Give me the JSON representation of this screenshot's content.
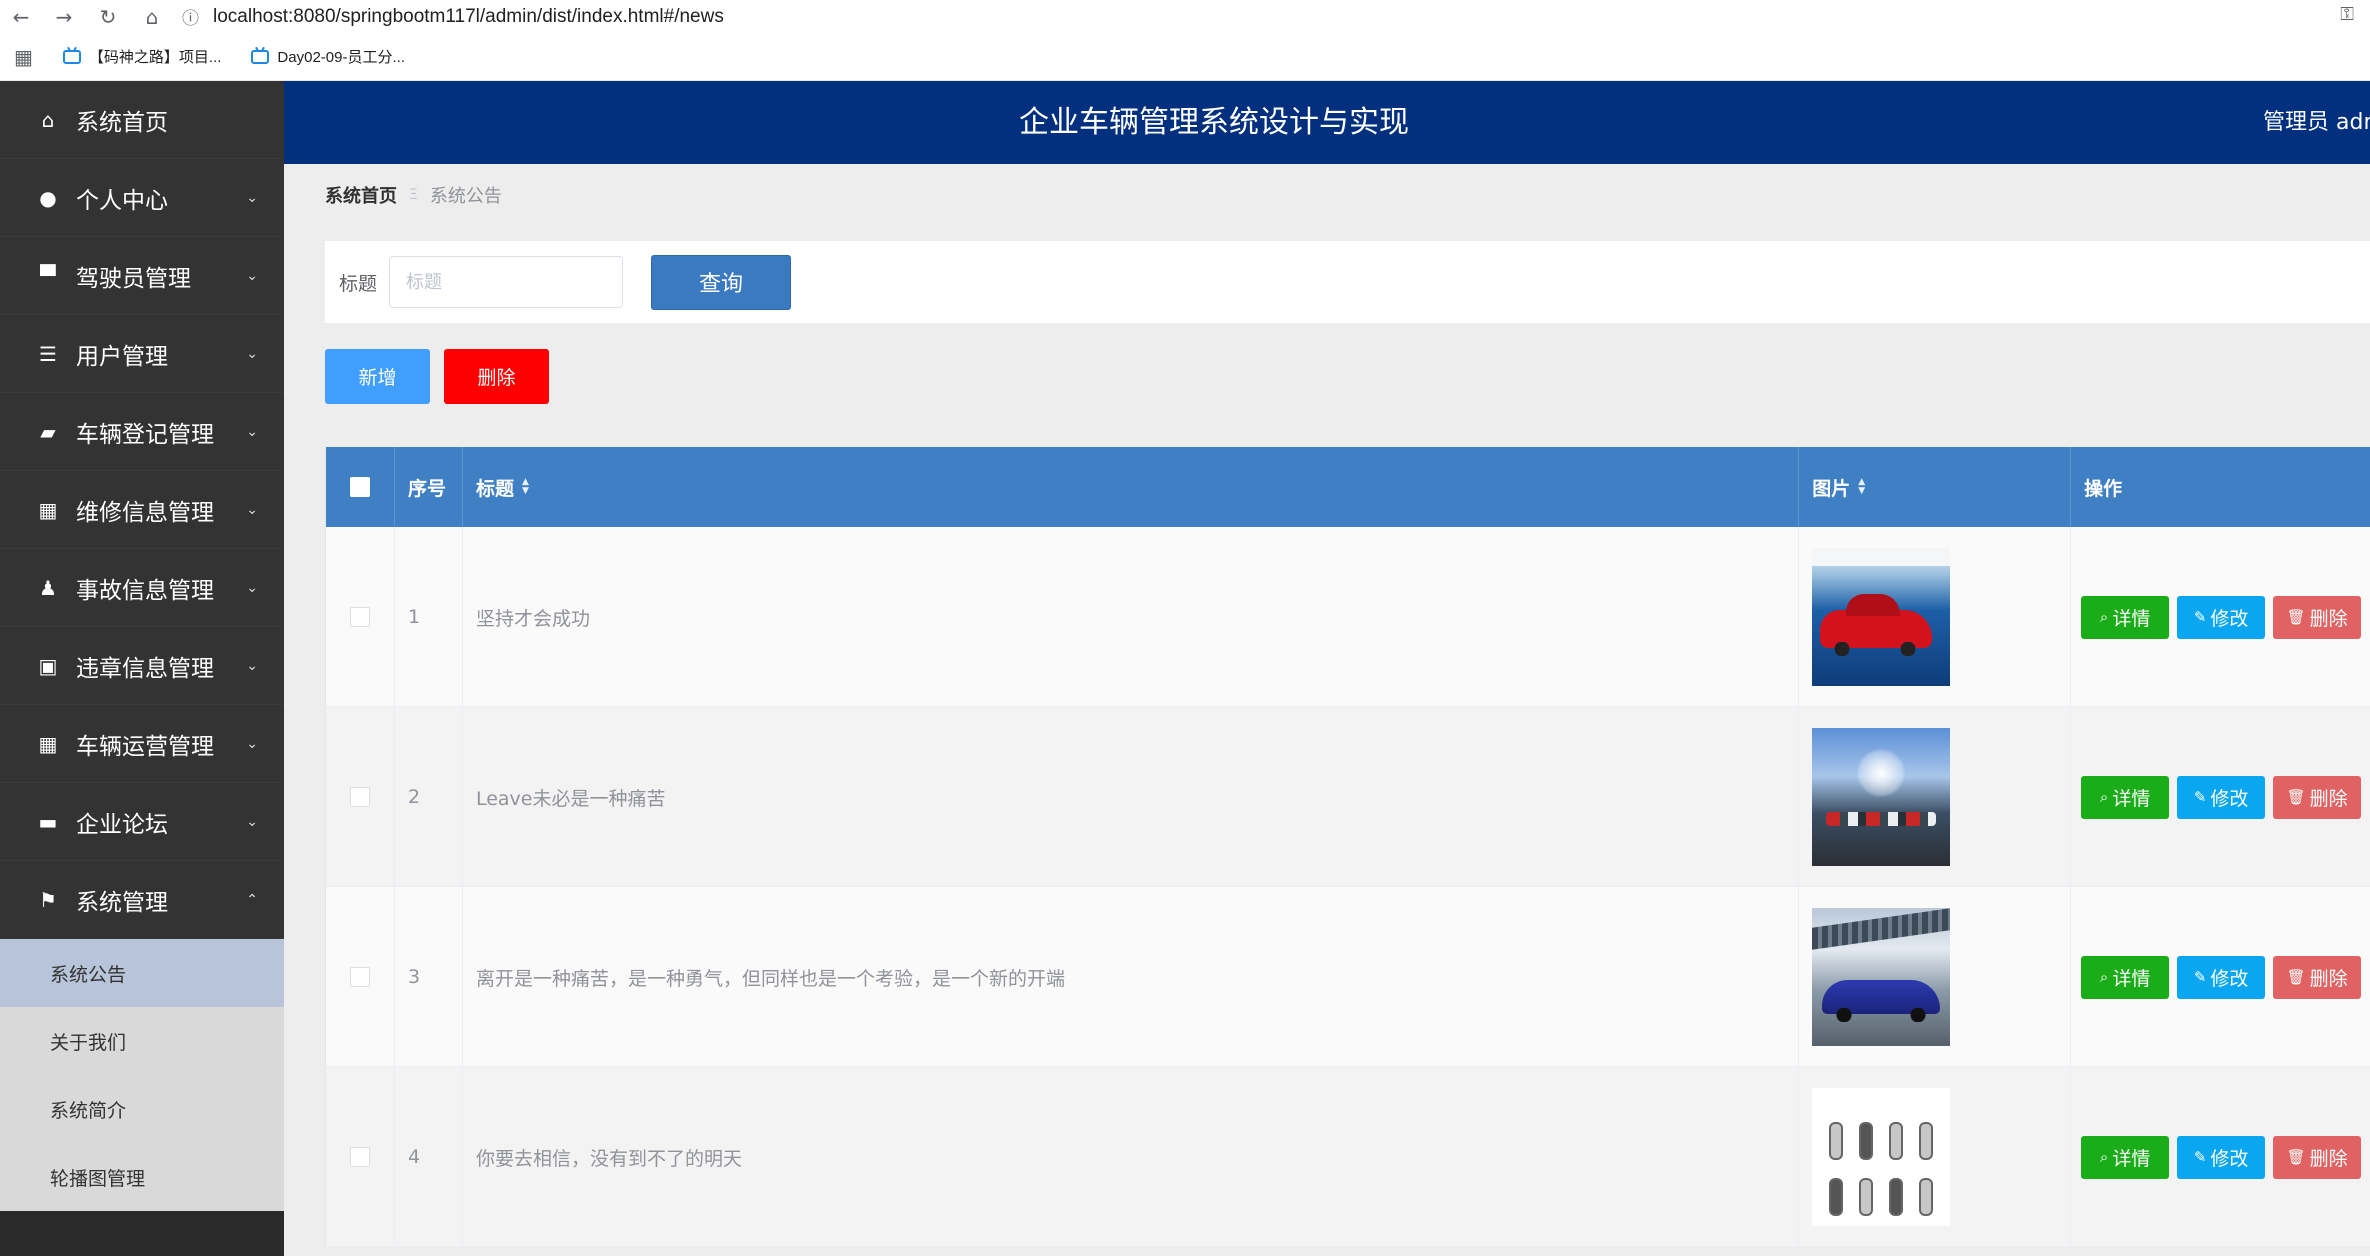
{
  "browser": {
    "url": "localhost:8080/springbootm117l/admin/dist/index.html#/news",
    "bookmarks": [
      "【码神之路】项目...",
      "Day02-09-员工分..."
    ]
  },
  "sidebar": {
    "items": [
      {
        "label": "系统首页",
        "icon": "home-icon"
      },
      {
        "label": "个人中心",
        "icon": "user-icon"
      },
      {
        "label": "驾驶员管理",
        "icon": "driver-icon"
      },
      {
        "label": "用户管理",
        "icon": "sliders-icon"
      },
      {
        "label": "车辆登记管理",
        "icon": "wallet-icon"
      },
      {
        "label": "维修信息管理",
        "icon": "grid-icon"
      },
      {
        "label": "事故信息管理",
        "icon": "stamp-icon"
      },
      {
        "label": "违章信息管理",
        "icon": "briefcase-icon"
      },
      {
        "label": "车辆运营管理",
        "icon": "grid-icon"
      },
      {
        "label": "企业论坛",
        "icon": "ticket-icon"
      },
      {
        "label": "系统管理",
        "icon": "flag-icon"
      }
    ],
    "submenu": [
      "系统公告",
      "关于我们",
      "系统简介",
      "轮播图管理"
    ]
  },
  "header": {
    "title": "企业车辆管理系统设计与实现",
    "user": "管理员 admin"
  },
  "breadcrumb": {
    "home": "系统首页",
    "current": "系统公告"
  },
  "search": {
    "label": "标题",
    "placeholder": "标题",
    "button": "查询"
  },
  "actions": {
    "add": "新增",
    "delete": "删除"
  },
  "table": {
    "columns": {
      "no": "序号",
      "title": "标题",
      "image": "图片",
      "operation": "操作"
    },
    "rows": [
      {
        "no": "1",
        "title": "坚持才会成功"
      },
      {
        "no": "2",
        "title": "Leave未必是一种痛苦"
      },
      {
        "no": "3",
        "title": "离开是一种痛苦，是一种勇气，但同样也是一个考验，是一个新的开端"
      },
      {
        "no": "4",
        "title": "你要去相信，没有到不了的明天"
      }
    ],
    "row_actions": {
      "detail": "详情",
      "edit": "修改",
      "remove": "删除"
    }
  },
  "colors": {
    "header_bg": "#02307e",
    "table_head_bg": "#3f7fc4",
    "sidebar_bg": "#333333",
    "detail_btn": "#1aad19",
    "edit_btn": "#0aa7f0",
    "remove_btn": "#e06262",
    "delete_btn": "#ff0000",
    "add_btn": "#409eff"
  }
}
